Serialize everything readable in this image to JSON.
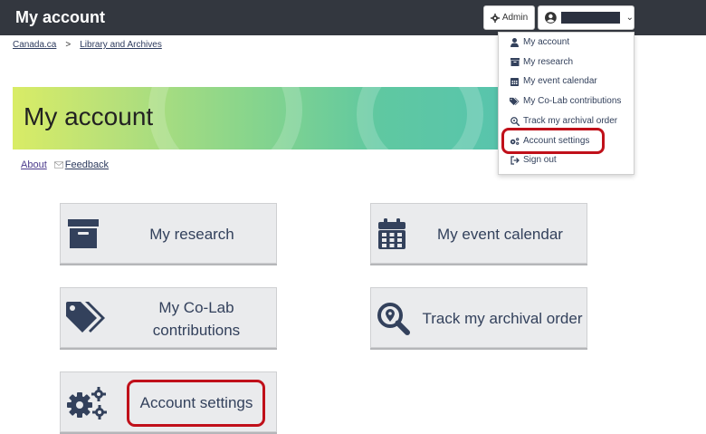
{
  "header": {
    "title": "My account",
    "admin_label": "Admin"
  },
  "breadcrumb": {
    "home": "Canada.ca",
    "separator": ">",
    "section": "Library and Archives"
  },
  "banner": {
    "title": "My account"
  },
  "links": {
    "about": "About",
    "feedback": "Feedback"
  },
  "tiles": {
    "research": "My research",
    "event_calendar": "My event calendar",
    "colab_line1": "My Co-Lab",
    "colab_line2": "contributions",
    "archival_order": "Track my archival order",
    "account_settings": "Account settings"
  },
  "menu": {
    "items": [
      {
        "label": "My account",
        "icon": "user-icon"
      },
      {
        "label": "My research",
        "icon": "archive-box-icon"
      },
      {
        "label": "My event calendar",
        "icon": "calendar-icon"
      },
      {
        "label": "My Co-Lab contributions",
        "icon": "tags-icon"
      },
      {
        "label": "Track my archival order",
        "icon": "search-location-icon"
      },
      {
        "label": "Account settings",
        "icon": "gears-icon"
      },
      {
        "label": "Sign out",
        "icon": "sign-out-icon"
      }
    ]
  },
  "colors": {
    "topbar": "#33373f",
    "tile_text": "#33415c",
    "highlight": "#c0101a"
  }
}
